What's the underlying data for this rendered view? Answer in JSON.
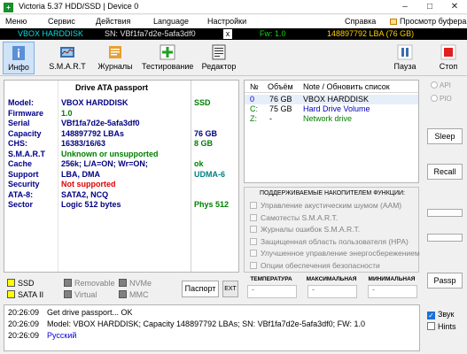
{
  "window": {
    "title": "Victoria 5.37 HDD/SSD | Device 0"
  },
  "menu": {
    "items": [
      "Меню",
      "Сервис",
      "Действия",
      "Language",
      "Настройки",
      "Справка"
    ],
    "viewer": "Просмотр буфера"
  },
  "info": {
    "drive": "VBOX HARDDISK",
    "serial": "SN: VBf1fa7d2e-5afa3df0",
    "close": "x",
    "fw": "Fw: 1.0",
    "capacity": "148897792 LBA (76 GB)"
  },
  "toolbar": {
    "left": [
      "Инфо",
      "S.M.A.R.T",
      "Журналы",
      "Тестирование",
      "Редактор"
    ],
    "pause": "Пауза",
    "stop": "Стоп"
  },
  "passport": {
    "title": "Drive ATA passport",
    "rows": [
      {
        "label": "Model:",
        "value": "VBOX HARDDISK",
        "extra": "SSD",
        "label_color": "#00008b",
        "value_color": "#000080",
        "extra_color": "#008000"
      },
      {
        "label": "Firmware",
        "value": "1.0",
        "extra": "",
        "label_color": "#00008b",
        "value_color": "#008000",
        "extra_color": "#008000"
      },
      {
        "label": "Serial",
        "value": "VBf1fa7d2e-5afa3df0",
        "extra": "",
        "label_color": "#00008b",
        "value_color": "#000080",
        "extra_color": "#008000"
      },
      {
        "label": "Capacity",
        "value": "148897792 LBAs",
        "extra": "76 GB",
        "label_color": "#00008b",
        "value_color": "#000080",
        "extra_color": "#000080"
      },
      {
        "label": "CHS:",
        "value": "16383/16/63",
        "extra": "8 GB",
        "label_color": "#00008b",
        "value_color": "#000080",
        "extra_color": "#008000"
      },
      {
        "label": "S.M.A.R.T",
        "value": "Unknown or unsupported",
        "extra": "",
        "label_color": "#00008b",
        "value_color": "#008000",
        "extra_color": "#008000"
      },
      {
        "label": "Cache",
        "value": "256k; L/A=ON; Wr=ON;",
        "extra": "ok",
        "label_color": "#00008b",
        "value_color": "#000080",
        "extra_color": "#008000"
      },
      {
        "label": "Support",
        "value": "LBA, DMA",
        "extra": "UDMA-6",
        "label_color": "#00008b",
        "value_color": "#000080",
        "extra_color": "#008080"
      },
      {
        "label": "Security",
        "value": "Not supported",
        "extra": "",
        "label_color": "#00008b",
        "value_color": "#e00000",
        "extra_color": "#008000"
      },
      {
        "label": "ATA-8:",
        "value": "SATA2, NCQ",
        "extra": "",
        "label_color": "#00008b",
        "value_color": "#000080",
        "extra_color": "#008000"
      },
      {
        "label": "Sector",
        "value": "Logic 512 bytes",
        "extra": "Phys 512",
        "label_color": "#00008b",
        "value_color": "#000080",
        "extra_color": "#008000"
      }
    ]
  },
  "volumes": {
    "headers": [
      "№",
      "Объём",
      "Note / Обновить список"
    ],
    "rows": [
      {
        "num": "0",
        "size": "76 GB",
        "note": "VBOX HARDDISK",
        "num_color": "#0000c0",
        "note_color": "#000000"
      },
      {
        "num": "C:",
        "size": "75 GB",
        "note": "Hard Drive Volume",
        "num_color": "#008000",
        "note_color": "#0000c0"
      },
      {
        "num": "Z:",
        "size": "-",
        "note": "Network drive",
        "num_color": "#008000",
        "note_color": "#008000"
      }
    ]
  },
  "features": {
    "title": "ПОДДЕРЖИВАЕМЫЕ НАКОПИТЕЛЕМ ФУНКЦИИ:",
    "items": [
      "Управление акустическим шумом (AAM)",
      "Самотесты S.M.A.R.T.",
      "Журналы ошибок S.M.A.R.T.",
      "Защищенная область пользователя (HPA)",
      "Улучшенное управление энергосбережением",
      "Опции обеспечения безопасности"
    ]
  },
  "legend": {
    "items": [
      {
        "label": "SSD",
        "color": "#ffff00"
      },
      {
        "label": "Removable",
        "color": "#808080"
      },
      {
        "label": "NVMe",
        "color": "#808080"
      },
      {
        "label": "SATA II",
        "color": "#ffff00"
      },
      {
        "label": "Virtual",
        "color": "#808080"
      },
      {
        "label": "MMC",
        "color": "#808080"
      }
    ],
    "passport_btn": "Паспорт",
    "ext_btn": "EXT"
  },
  "sensors": {
    "temperature": {
      "label": "ТЕМПЕРАТУРА",
      "value": "-"
    },
    "max": {
      "label": "МАКСИМАЛЬНАЯ",
      "value": "-"
    },
    "min": {
      "label": "МИНИМАЛЬНАЯ",
      "value": "-"
    }
  },
  "side": {
    "api": "API",
    "pio": "PIO",
    "sleep": "Sleep",
    "recall": "Recall",
    "passp": "Passp"
  },
  "log": {
    "rows": [
      {
        "time": "20:26:09",
        "msg": "Get drive passport... OK",
        "color": "#000000"
      },
      {
        "time": "20:26:09",
        "msg": "Model: VBOX HARDDISK; Capacity 148897792 LBAs; SN: VBf1fa7d2e-5afa3df0; FW: 1.0",
        "color": "#000000"
      },
      {
        "time": "20:26:09",
        "msg": "Русский",
        "color": "#0000e0"
      }
    ]
  },
  "logside": {
    "sound": "Звук",
    "hints": "Hints"
  }
}
